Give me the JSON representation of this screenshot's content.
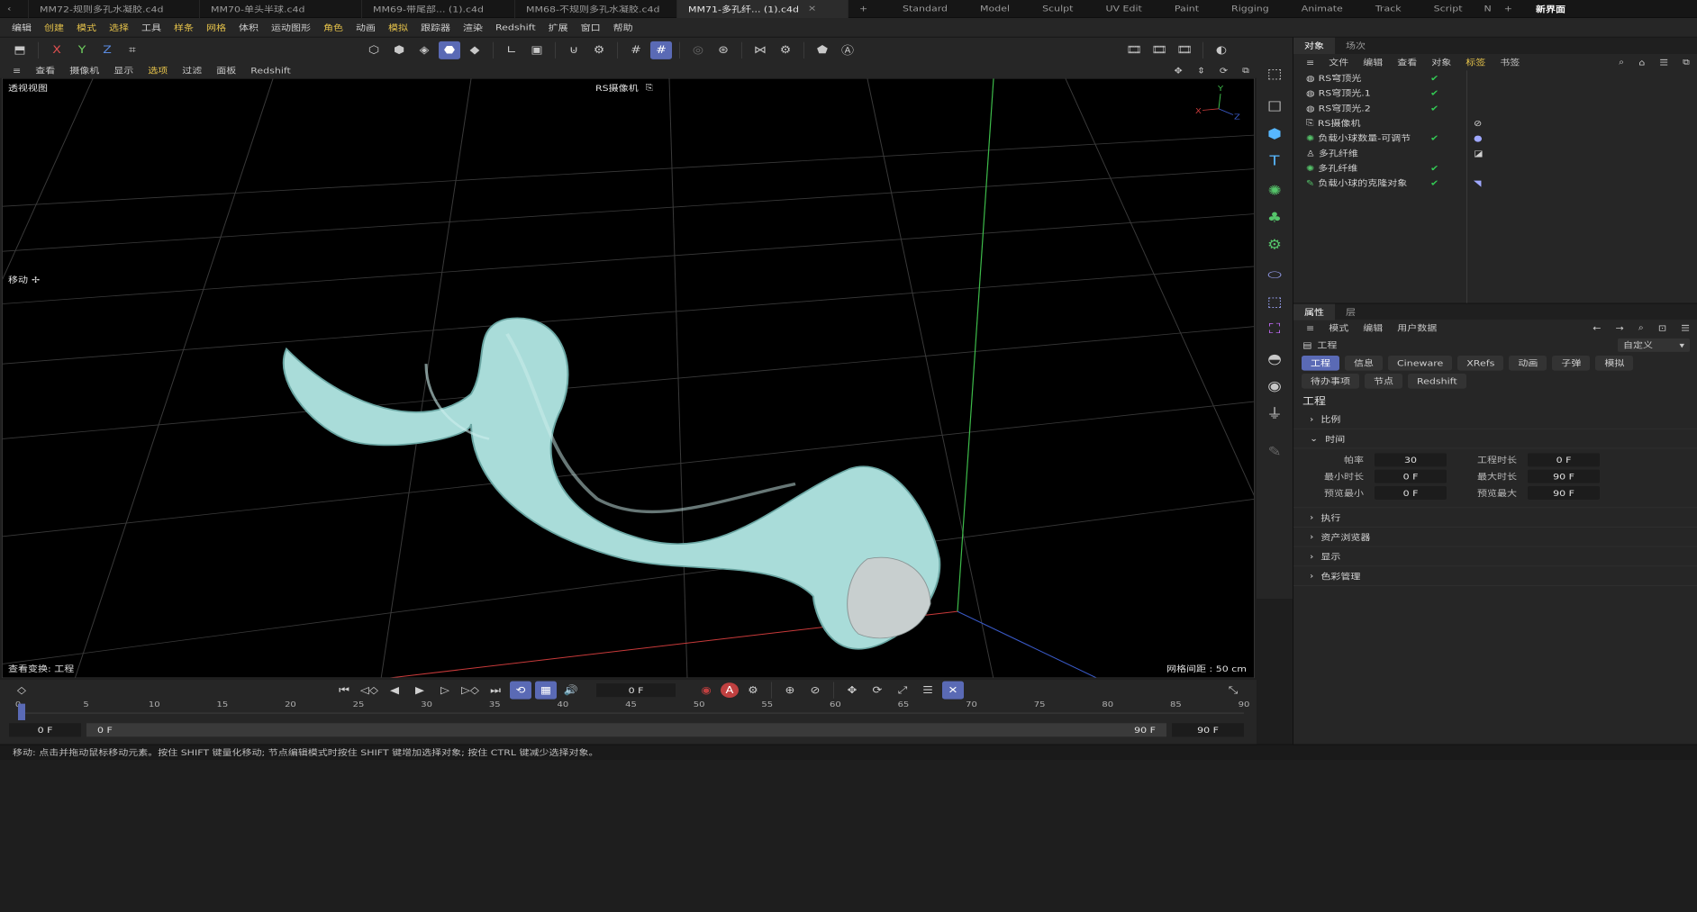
{
  "file_tabs": [
    "MM72-规则多孔水凝胶.c4d",
    "MM70-单头半球.c4d",
    "MM69-带尾部... (1).c4d",
    "MM68-不规则多孔水凝胶.c4d",
    "MM71-多孔纤... (1).c4d"
  ],
  "active_file_tab": 4,
  "layout_tabs": [
    "Standard",
    "Model",
    "Sculpt",
    "UV Edit",
    "Paint",
    "Rigging",
    "Animate",
    "Track",
    "Script",
    "N"
  ],
  "new_layout": "新界面",
  "menu": [
    "编辑",
    "创建",
    "模式",
    "选择",
    "工具",
    "样条",
    "网格",
    "体积",
    "运动图形",
    "角色",
    "动画",
    "模拟",
    "跟踪器",
    "渲染",
    "Redshift",
    "扩展",
    "窗口",
    "帮助"
  ],
  "axis_toggles": [
    "X",
    "Y",
    "Z"
  ],
  "viewport_menu": [
    "查看",
    "摄像机",
    "显示",
    "选项",
    "过滤",
    "面板",
    "Redshift"
  ],
  "viewport": {
    "name": "透视视图",
    "camera": "RS摄像机",
    "tool": "移动",
    "view_transform": "查看变换: 工程",
    "grid_spacing": "网格间距 : 50 cm"
  },
  "panel_tabs": [
    "对象",
    "场次"
  ],
  "object_menu": [
    "文件",
    "编辑",
    "查看",
    "对象",
    "标签",
    "书签"
  ],
  "objects": [
    "RS穹顶光",
    "RS穹顶光.1",
    "RS穹顶光.2",
    "RS摄像机",
    "负载小球数量-可调节",
    "多孔纤维",
    "多孔纤维",
    "负载小球的克隆对象"
  ],
  "attr_tabs": [
    "属性",
    "层"
  ],
  "attr_menu": [
    "模式",
    "编辑",
    "用户数据"
  ],
  "attr_title": "工程",
  "attr_preset": "自定义",
  "attr_subtabs": [
    "工程",
    "信息",
    "Cineware",
    "XRefs",
    "动画",
    "子弹",
    "模拟"
  ],
  "attr_subtabs2": [
    "待办事项",
    "节点",
    "Redshift"
  ],
  "section_title": "工程",
  "sections": {
    "scale": "比例",
    "time": "时间",
    "exec": "执行",
    "asset": "资产浏览器",
    "display": "显示",
    "color": "色彩管理"
  },
  "time_fields": {
    "fps_label": "帕率",
    "fps": "30",
    "proj_len_label": "工程时长",
    "proj_len": "0 F",
    "min_label": "最小时长",
    "min": "0 F",
    "max_label": "最大时长",
    "max": "90 F",
    "pmin_label": "预览最小",
    "pmin": "0 F",
    "pmax_label": "预览最大",
    "pmax": "90 F"
  },
  "timeline": {
    "current": "0 F",
    "start": "0 F",
    "range_start": "0 F",
    "range_end": "90 F",
    "end": "90 F",
    "ticks": [
      "0",
      "5",
      "10",
      "15",
      "20",
      "25",
      "30",
      "35",
      "40",
      "45",
      "50",
      "55",
      "60",
      "65",
      "70",
      "75",
      "80",
      "85",
      "90"
    ]
  },
  "status": "移动: 点击并拖动鼠标移动元素。按住 SHIFT 键量化移动; 节点编辑模式时按住 SHIFT 键增加选择对象; 按住 CTRL 键减少选择对象。",
  "colors": {
    "accent": "#5a6ab5",
    "yellow": "#e6c34a",
    "sphere": "#a9dcd9",
    "green": "#33cc55"
  }
}
